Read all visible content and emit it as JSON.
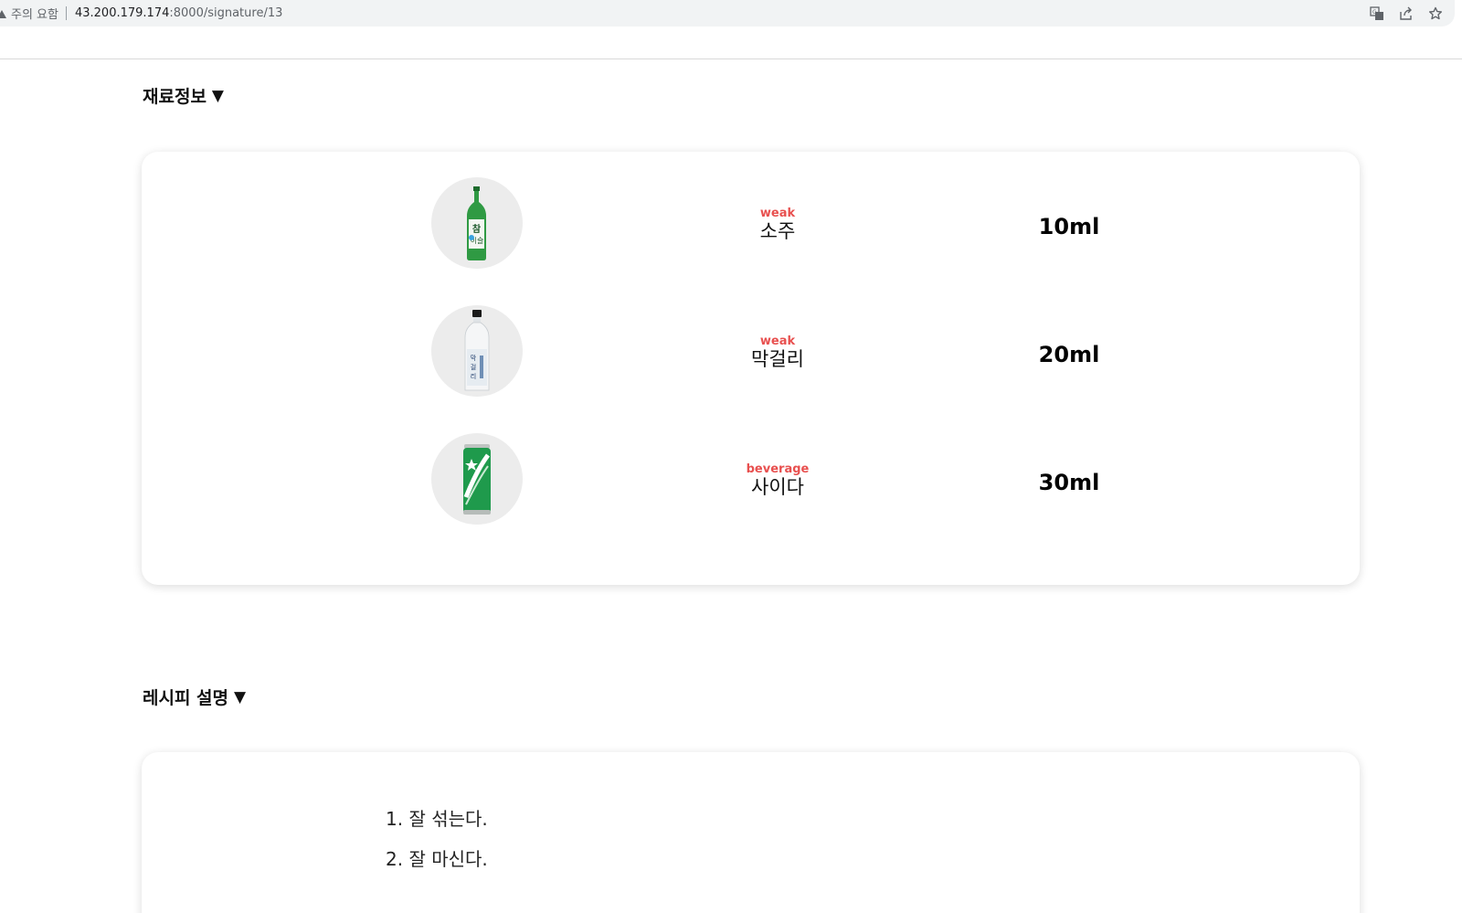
{
  "browser": {
    "security_label": "주의 요함",
    "url_host": "43.200.179.174",
    "url_path": ":8000/signature/13",
    "icons": [
      "warning-icon",
      "translate-icon",
      "share-icon",
      "bookmark-star-icon"
    ]
  },
  "ingredients_section": {
    "title": "재료정보",
    "toggle_arrow": "▼",
    "items": [
      {
        "tag": "weak",
        "name": "소주",
        "amount": "10ml",
        "icon": "soju-bottle-image"
      },
      {
        "tag": "weak",
        "name": "막걸리",
        "amount": "20ml",
        "icon": "makgeolli-bottle-image"
      },
      {
        "tag": "beverage",
        "name": "사이다",
        "amount": "30ml",
        "icon": "cider-can-image"
      }
    ]
  },
  "recipe_section": {
    "title": "레시피 설명",
    "toggle_arrow": "▼",
    "steps": [
      "1. 잘 섞는다.",
      "2. 잘 마신다."
    ]
  },
  "colors": {
    "tag_red": "#e8504f",
    "thumb_bg": "#ececec",
    "card_bg": "#ffffff"
  }
}
